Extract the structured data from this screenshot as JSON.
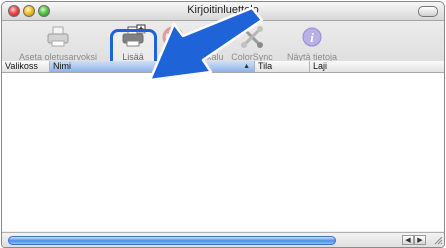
{
  "window": {
    "title": "Kirjoitinluettelo"
  },
  "toolbar": {
    "items": [
      {
        "label": "Aseta oletusarvoksi",
        "icon": "printer-default-icon",
        "active": false
      },
      {
        "label": "Lisää",
        "icon": "printer-add-icon",
        "active": true
      },
      {
        "label": "Poista",
        "icon": "delete-icon",
        "active": false
      },
      {
        "label": "Työkalu",
        "icon": "utility-icon",
        "active": false
      },
      {
        "label": "ColorSync",
        "icon": "colorsync-icon",
        "active": false
      },
      {
        "label": "Näytä tietoja",
        "icon": "info-icon",
        "active": false
      }
    ]
  },
  "table": {
    "columns": [
      "Valikoss",
      "Nimi",
      "Tila",
      "Laji"
    ],
    "sorted_column": "Nimi",
    "rows": []
  },
  "colors": {
    "highlight": "#1f63d8",
    "arrow": "#1f63d8"
  }
}
